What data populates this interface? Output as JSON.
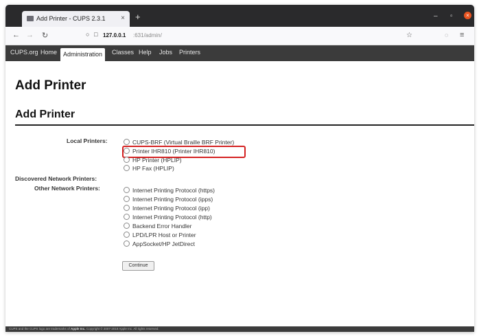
{
  "browser": {
    "tab_title": "Add Printer - CUPS 2.3.1",
    "close_glyph": "×",
    "new_tab_glyph": "+",
    "url_host": "127.0.0.1",
    "url_path": ":631/admin/"
  },
  "cups_nav": {
    "items": [
      "CUPS.org",
      "Home",
      "Administration",
      "Classes",
      "Help",
      "Jobs",
      "Printers"
    ],
    "active": "Administration"
  },
  "page": {
    "heading": "Add Printer",
    "subheading": "Add Printer",
    "local_label": "Local Printers:",
    "local_options": [
      "CUPS-BRF (Virtual Braille BRF Printer)",
      "Printer IHR810 (Printer IHR810)",
      "HP Printer (HPLIP)",
      "HP Fax (HPLIP)"
    ],
    "discovered_label": "Discovered Network Printers:",
    "other_label": "Other Network Printers:",
    "other_options": [
      "Internet Printing Protocol (https)",
      "Internet Printing Protocol (ipps)",
      "Internet Printing Protocol (ipp)",
      "Internet Printing Protocol (http)",
      "Backend Error Handler",
      "LPD/LPR Host or Printer",
      "AppSocket/HP JetDirect"
    ],
    "continue_label": "Continue"
  },
  "footer": {
    "text_a": "CUPS and the CUPS logo are trademarks of ",
    "text_b": "Apple Inc.",
    "text_c": " Copyright © 2007-2019 Apple Inc. All rights reserved."
  },
  "colors": {
    "highlight": "#d42020",
    "cups_header": "#3b3b3b",
    "window_close": "#e95420"
  },
  "icons": [
    "document-icon",
    "close-icon",
    "plus-icon",
    "back-icon",
    "forward-icon",
    "reload-icon",
    "shield-icon",
    "page-icon",
    "star-icon",
    "hamburger-menu-icon",
    "minimize-icon",
    "maximize-icon",
    "window-close-icon"
  ]
}
